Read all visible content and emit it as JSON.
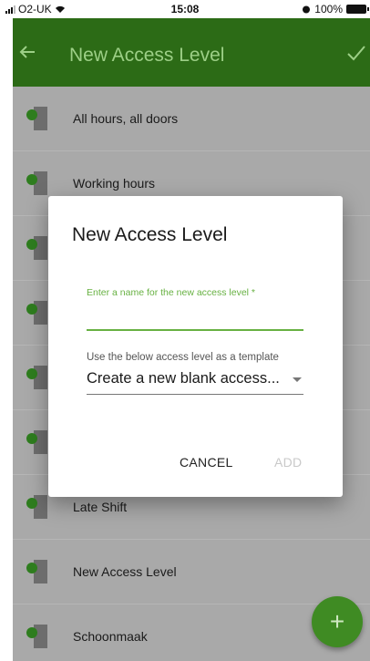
{
  "status_bar": {
    "carrier": "O2-UK",
    "time": "15:08",
    "battery": "100%"
  },
  "app_bar": {
    "title": "New Access Level"
  },
  "list": {
    "items": [
      {
        "label": "All hours, all doors"
      },
      {
        "label": "Working hours"
      },
      {
        "label": ""
      },
      {
        "label": ""
      },
      {
        "label": ""
      },
      {
        "label": ""
      },
      {
        "label": "Late Shift"
      },
      {
        "label": "New Access Level"
      },
      {
        "label": "Schoonmaak"
      }
    ]
  },
  "dialog": {
    "title": "New Access Level",
    "name_field": {
      "label": "Enter a name for the new access level *",
      "value": ""
    },
    "template_field": {
      "label": "Use the below access level as a template",
      "value": "Create a new blank access..."
    },
    "cancel_label": "CANCEL",
    "add_label": "ADD"
  },
  "colors": {
    "app_bar": "#2c6b16",
    "accent": "#67b142",
    "fab": "#3f8b23"
  }
}
